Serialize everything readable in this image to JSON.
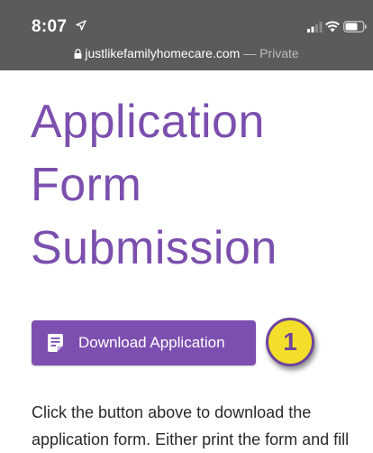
{
  "status_bar": {
    "time": "8:07",
    "icons": [
      "location-arrow-icon",
      "signal-icon",
      "wifi-icon",
      "battery-icon"
    ]
  },
  "address_bar": {
    "lock_icon": "lock-icon",
    "url": "justlikefamilyhomecare.com",
    "private_label": "— Private"
  },
  "page": {
    "title_lines": [
      "Application",
      "Form",
      "Submission"
    ],
    "download_button": {
      "icon": "document-icon",
      "label": "Download Application"
    },
    "step_badge": "1",
    "instructions_lines": [
      "Click the button above to download the",
      "application form. Either print the form and fill"
    ]
  },
  "colors": {
    "status_bar_bg": "#5b5b5b",
    "title_purple": "#7b4fae",
    "button_purple": "#7d4fb0",
    "badge_yellow": "#f3df2b",
    "badge_border": "#6e449d"
  }
}
